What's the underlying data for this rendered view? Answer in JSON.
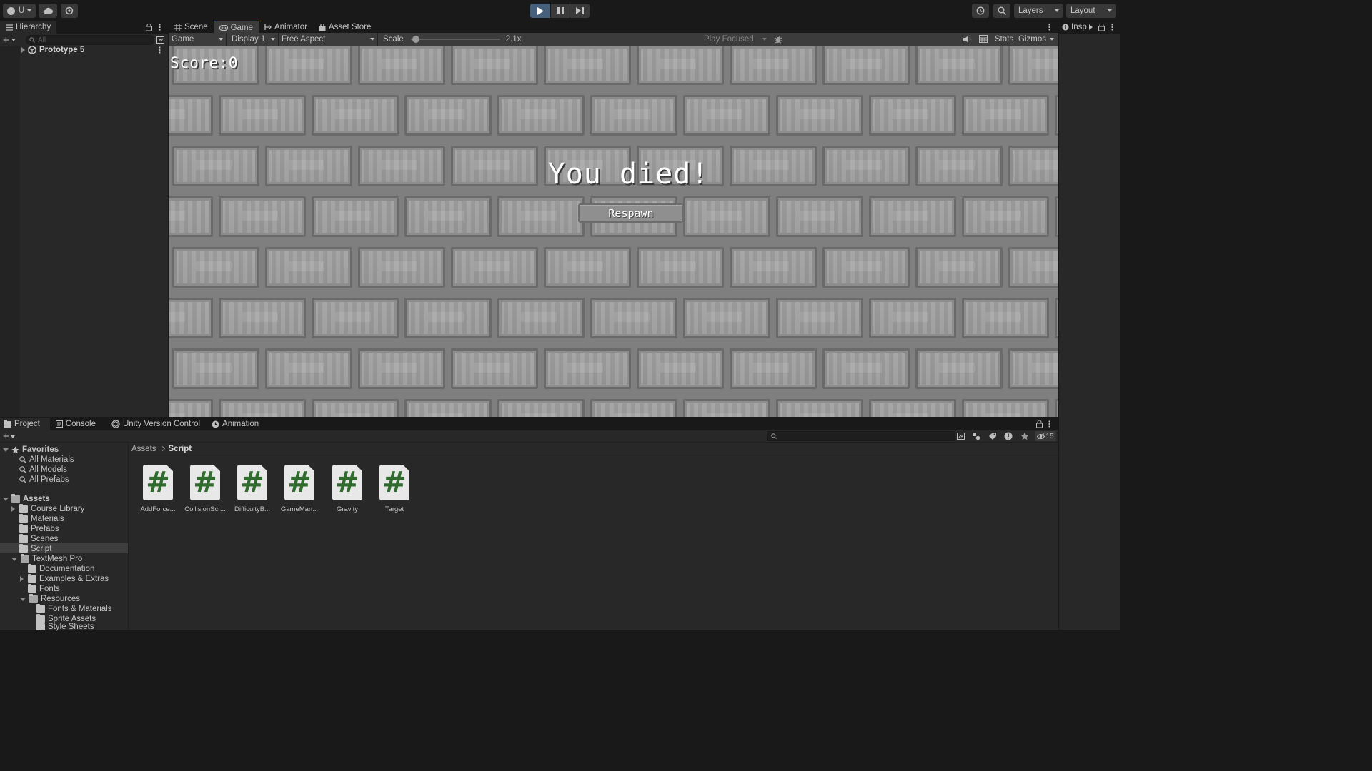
{
  "toolbar": {
    "account_label": "U",
    "layers_label": "Layers",
    "layout_label": "Layout",
    "icons": [
      "account-icon",
      "cloud-icon",
      "settings-icon",
      "play-icon",
      "pause-icon",
      "step-icon",
      "history-icon",
      "search-icon"
    ]
  },
  "hierarchy": {
    "tab_label": "Hierarchy",
    "search_placeholder": "All",
    "items": [
      {
        "label": "Prototype 5"
      }
    ]
  },
  "center_tabs": [
    {
      "label": "Scene"
    },
    {
      "label": "Game"
    },
    {
      "label": "Animator"
    },
    {
      "label": "Asset Store"
    }
  ],
  "game_toolbar": {
    "display_mode": "Game",
    "display": "Display 1",
    "aspect": "Free Aspect",
    "scale_label": "Scale",
    "scale_value": "2.1x",
    "scale_fraction": 0.02,
    "play_mode": "Play Focused",
    "stats_label": "Stats",
    "gizmos_label": "Gizmos"
  },
  "game_view": {
    "score_text": "Score:0",
    "death_text": "You died!",
    "respawn_label": "Respawn"
  },
  "inspector": {
    "tab_label": "Insp"
  },
  "bottom_tabs": [
    {
      "label": "Project"
    },
    {
      "label": "Console"
    },
    {
      "label": "Unity Version Control"
    },
    {
      "label": "Animation"
    }
  ],
  "project": {
    "hidden_count": "15",
    "favorites_label": "Favorites",
    "favorites": [
      "All Materials",
      "All Models",
      "All Prefabs"
    ],
    "assets_label": "Assets",
    "folders": [
      {
        "label": "Course Library"
      },
      {
        "label": "Materials"
      },
      {
        "label": "Prefabs"
      },
      {
        "label": "Scenes"
      },
      {
        "label": "Script"
      },
      {
        "label": "TextMesh Pro"
      },
      {
        "label": "Documentation"
      },
      {
        "label": "Examples & Extras"
      },
      {
        "label": "Fonts"
      },
      {
        "label": "Resources"
      },
      {
        "label": "Fonts & Materials"
      },
      {
        "label": "Sprite Assets"
      },
      {
        "label": "Style Sheets"
      }
    ],
    "breadcrumb": [
      "Assets",
      "Script"
    ],
    "files": [
      {
        "label": "AddForce..."
      },
      {
        "label": "CollisionScr..."
      },
      {
        "label": "DifficultyB..."
      },
      {
        "label": "GameMan..."
      },
      {
        "label": "Gravity"
      },
      {
        "label": "Target"
      }
    ]
  },
  "colors": {
    "accent": "#4f79b5",
    "play_active": "#46607c",
    "panel": "#282828",
    "background": "#191919",
    "script_hash": "#2e6b2c"
  }
}
